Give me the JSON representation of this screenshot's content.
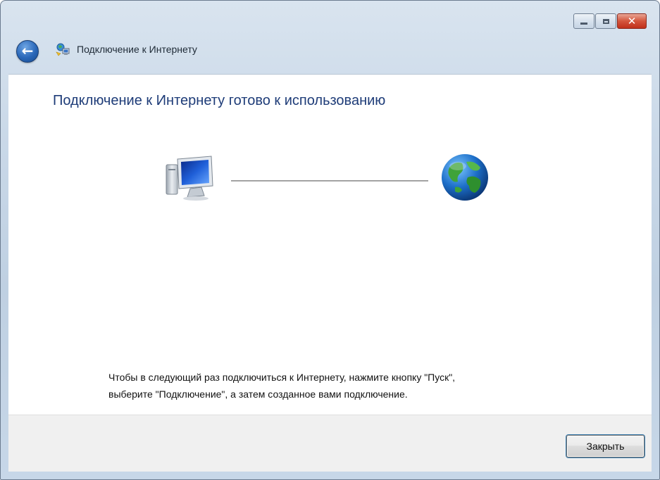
{
  "window": {
    "title": "Подключение к Интернету",
    "caption_buttons": [
      "minimize-icon",
      "maximize-icon",
      "close-icon"
    ],
    "close_glyph": "✕"
  },
  "navigation": {
    "back_icon": "back-arrow-icon",
    "back_glyph": "←"
  },
  "main": {
    "heading": "Подключение к Интернету готово к использованию",
    "diagram_icons": [
      "computer-icon",
      "globe-icon"
    ],
    "info_lines": [
      "Чтобы в следующий раз подключиться к Интернету, нажмите кнопку \"Пуск\",",
      "выберите \"Подключение\", а затем созданное вами подключение."
    ]
  },
  "footer": {
    "close_label": "Закрыть"
  },
  "colors": {
    "heading": "#1e3c78",
    "titlebar": "#c9d8e8",
    "footer": "#f0f0f0",
    "close_button_red": "#c0301a"
  }
}
